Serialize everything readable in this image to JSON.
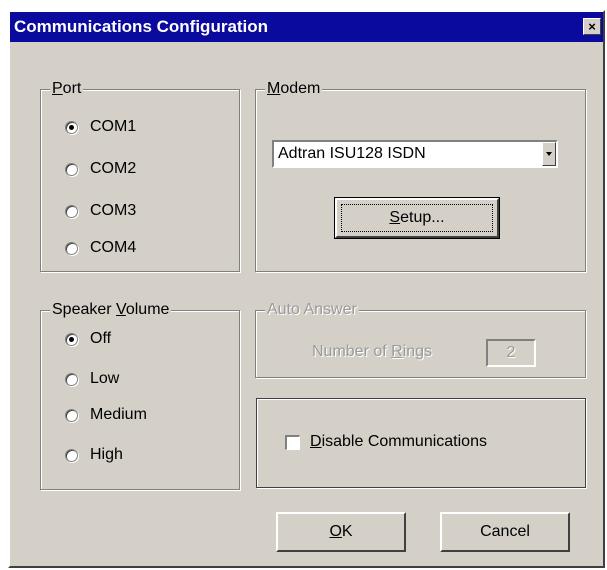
{
  "window": {
    "title": "Communications Configuration",
    "close_label": "×"
  },
  "port": {
    "label_prefix": "",
    "label_mnemonic": "P",
    "label_rest": "ort",
    "options": [
      "COM1",
      "COM2",
      "COM3",
      "COM4"
    ],
    "selected": "COM1"
  },
  "modem": {
    "label_mnemonic": "M",
    "label_rest": "odem",
    "selected_value": "Adtran ISU128 ISDN",
    "setup_mnemonic": "S",
    "setup_rest": "etup..."
  },
  "speaker": {
    "label_prefix": "Speaker ",
    "label_mnemonic": "V",
    "label_rest": "olume",
    "options": [
      "Off",
      "Low",
      "Medium",
      "High"
    ],
    "selected": "Off"
  },
  "auto_answer": {
    "label": "Auto Answer",
    "rings_prefix": "Number of ",
    "rings_mnemonic": "R",
    "rings_rest": "ings",
    "rings_value": "2",
    "enabled": false
  },
  "disable": {
    "mnemonic": "D",
    "rest": "isable Communications",
    "checked": false
  },
  "buttons": {
    "ok_mnemonic": "O",
    "ok_rest": "K",
    "cancel": "Cancel"
  },
  "colors": {
    "title_bar": "#0a0a9e",
    "face": "#d4d0c8",
    "disabled_text": "#9a9a9a"
  }
}
